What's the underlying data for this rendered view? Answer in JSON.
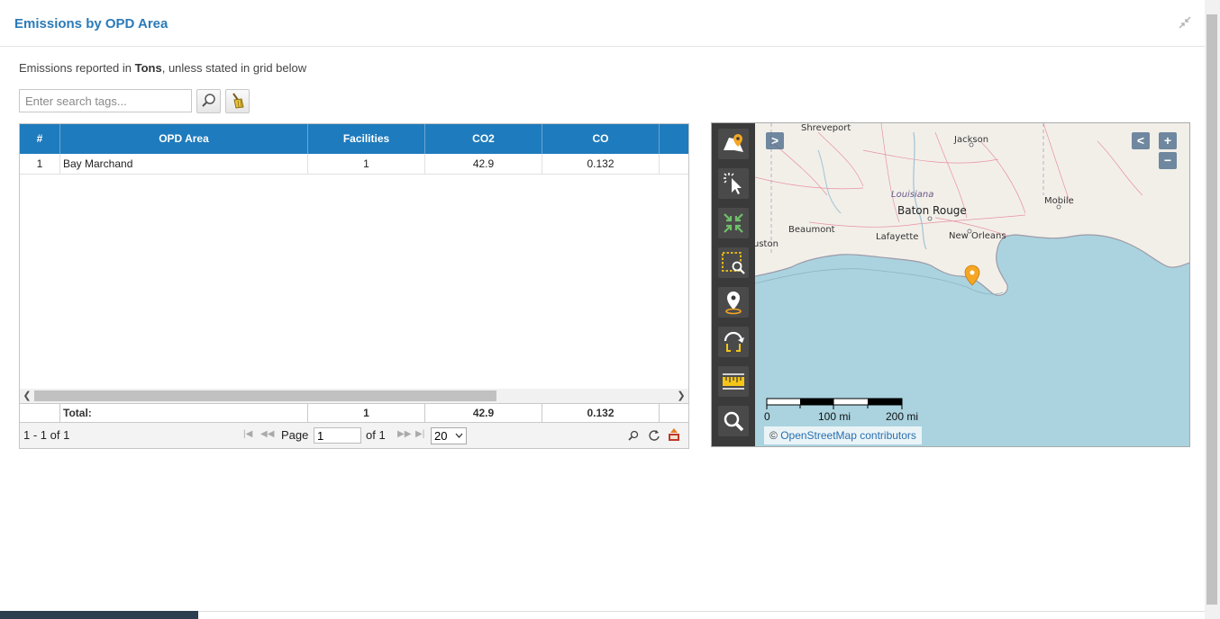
{
  "header": {
    "title": "Emissions by OPD Area"
  },
  "note": {
    "prefix": "Emissions reported in ",
    "unit": "Tons",
    "suffix": ", unless stated in grid below"
  },
  "search": {
    "placeholder": "Enter search tags..."
  },
  "grid": {
    "columns": [
      "#",
      "OPD Area",
      "Facilities",
      "CO2",
      "CO"
    ],
    "rows": [
      {
        "num": "1",
        "area": "Bay Marchand",
        "facilities": "1",
        "co2": "42.9",
        "co": "0.132"
      }
    ],
    "totals": {
      "label": "Total:",
      "facilities": "1",
      "co2": "42.9",
      "co": "0.132"
    }
  },
  "pager": {
    "range": "1 - 1 of 1",
    "page_label": "Page",
    "page_value": "1",
    "of_label": "of 1",
    "page_size": "20"
  },
  "map": {
    "places": [
      "Shreveport",
      "Jackson",
      "Louisiana",
      "Baton Rouge",
      "Mobile",
      "Beaumont",
      "Lafayette",
      "New Orleans",
      "uston"
    ],
    "scale": {
      "zero": "0",
      "mid": "100 mi",
      "max": "200 mi"
    },
    "attribution_symbol": "©",
    "attribution_link": "OpenStreetMap contributors",
    "expand_label": ">",
    "collapse_label": "<",
    "zoom_in": "+",
    "zoom_out": "−"
  },
  "tools": [
    "layers-pin-icon",
    "select-pointer-icon",
    "zoom-extent-icon",
    "zoom-box-icon",
    "location-pin-icon",
    "reset-view-icon",
    "measure-ruler-icon",
    "search-magnifier-icon"
  ],
  "colors": {
    "accent": "#1e7bbd",
    "title": "#2a7ab8",
    "toolbar": "#3a3a3a",
    "water": "#aad3df",
    "land": "#f2efe9",
    "marker": "#f5a623"
  }
}
